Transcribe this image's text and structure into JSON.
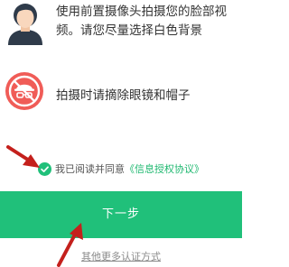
{
  "tips": [
    {
      "icon": "avatar-icon",
      "text": "使用前置摄像头拍摄您的脸部视频。请您尽量选择白色背景"
    },
    {
      "icon": "no-glasses-hat-icon",
      "text": "拍摄时请摘除眼镜和帽子"
    }
  ],
  "agreement": {
    "prefix": "我已阅读并同意",
    "link": "《信息授权协议》"
  },
  "next_button": "下一步",
  "other_methods": "其他更多认证方式",
  "colors": {
    "accent": "#20c07a",
    "annotation_arrow": "#c4201c",
    "hair": "#2f3b4a",
    "skin": "#f9d7bd",
    "no_sign": "#f05c57"
  }
}
